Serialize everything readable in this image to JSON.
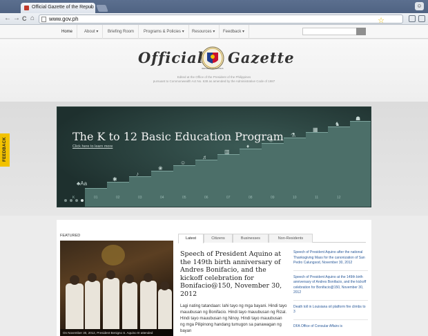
{
  "browser": {
    "tab_title": "Official Gazette of the Repub",
    "tab_close": "×",
    "url": "www.gov.ph",
    "back": "←",
    "forward": "→",
    "reload": "C",
    "home": "⌂",
    "star": "☆",
    "profile": "☺"
  },
  "nav": {
    "items": [
      "Home",
      "About",
      "Briefing Room",
      "Programs & Policies",
      "Resources",
      "Feedback"
    ],
    "search_placeholder": ""
  },
  "masthead": {
    "logo_left": "Official",
    "logo_right": "Gazette",
    "seal_motto": "REPUBLIKA NG PILIPINAS",
    "tagline_1": "Edited at the Office of the President of the Philippines",
    "tagline_2": "pursuant to Commonwealth Act No. 638 as amended by the Administrative Code of 1987"
  },
  "hero": {
    "title": "The K to 12 Basic Education Program",
    "link": "Click here to learn more",
    "grades": [
      "K",
      "01",
      "02",
      "03",
      "04",
      "05",
      "06",
      "07",
      "08",
      "09",
      "10",
      "11",
      "12"
    ],
    "icons": [
      "♣Aa",
      "✱",
      "♪",
      "❀",
      "☺",
      "♬",
      "▥",
      "♦",
      "⚛",
      "⚗",
      "▦",
      "♞",
      "☗"
    ]
  },
  "feedback_tab": "FEEDBACK",
  "featured": {
    "label": "FEATURED",
    "caption": "On November 30, 2012, President Benigno S. Aquino III attended"
  },
  "tabs": [
    "Latest",
    "Citizens",
    "Businesses",
    "Non-Residents"
  ],
  "article": {
    "title": "Speech of President Aquino at the 149th birth anniversary of Andres Bonifacio, and the kickoff celebration for Bonifacio@150, November 30, 2012",
    "body": "Lagi nating tatandaan: lahi tayo ng mga bayani. Hindi tayo mauubusan ng Bonifacio. Hindi tayo mauubusan ng Rizal. Hindi tayo mauubusan ng Ninoy. Hindi tayo mauubusan ng mga Pilipinong handang tumugon sa panawagan ng bayan"
  },
  "side_news": [
    "Speech of President Aquino after the national Thanksgiving Mass for the canonization of San Pedro Calungsod, November 30, 2012",
    "Speech of President Aquino at the 149th birth anniversary of Andres Bonifacio, and the kickoff celebration for Bonifacio@150, November 30, 2012",
    "Death toll in Louisiana oil platform fire climbs to 3",
    "DFA Office of Consular Affairs is"
  ],
  "colors": {
    "feedback": "#f2c200",
    "hero_bg": "#2b4541",
    "link": "#2a5a9a"
  }
}
